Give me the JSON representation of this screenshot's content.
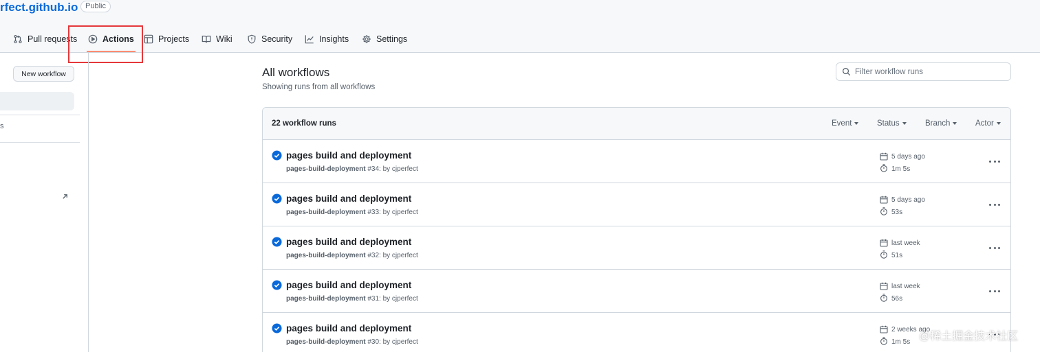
{
  "repo": {
    "name": "rfect.github.io",
    "visibility": "Public"
  },
  "nav": {
    "tabs": [
      {
        "label": "Pull requests",
        "icon": "pull-request-icon"
      },
      {
        "label": "Actions",
        "icon": "play-icon",
        "active": true
      },
      {
        "label": "Projects",
        "icon": "table-icon"
      },
      {
        "label": "Wiki",
        "icon": "book-icon"
      },
      {
        "label": "Security",
        "icon": "shield-icon"
      },
      {
        "label": "Insights",
        "icon": "graph-icon"
      },
      {
        "label": "Settings",
        "icon": "gear-icon"
      }
    ]
  },
  "sidebar": {
    "new_workflow_label": "New workflow",
    "fragment": "s"
  },
  "main": {
    "title": "All workflows",
    "subtitle": "Showing runs from all workflows",
    "filter_placeholder": "Filter workflow runs"
  },
  "runs": {
    "count_label": "22 workflow runs",
    "filters": [
      "Event",
      "Status",
      "Branch",
      "Actor"
    ],
    "items": [
      {
        "title": "pages build and deployment",
        "workflow": "pages-build-deployment",
        "number": "#34",
        "by": ": by cjperfect",
        "date": "5 days ago",
        "duration": "1m 5s"
      },
      {
        "title": "pages build and deployment",
        "workflow": "pages-build-deployment",
        "number": "#33",
        "by": ": by cjperfect",
        "date": "5 days ago",
        "duration": "53s"
      },
      {
        "title": "pages build and deployment",
        "workflow": "pages-build-deployment",
        "number": "#32",
        "by": ": by cjperfect",
        "date": "last week",
        "duration": "51s"
      },
      {
        "title": "pages build and deployment",
        "workflow": "pages-build-deployment",
        "number": "#31",
        "by": ": by cjperfect",
        "date": "last week",
        "duration": "56s"
      },
      {
        "title": "pages build and deployment",
        "workflow": "pages-build-deployment",
        "number": "#30",
        "by": ": by cjperfect",
        "date": "2 weeks ago",
        "duration": "1m 5s"
      }
    ]
  },
  "watermark": "@稀土掘金技术社区",
  "colors": {
    "link": "#0969da",
    "success": "#0969da",
    "active_underline": "#fd8c73",
    "highlight_box": "#e5383b"
  }
}
